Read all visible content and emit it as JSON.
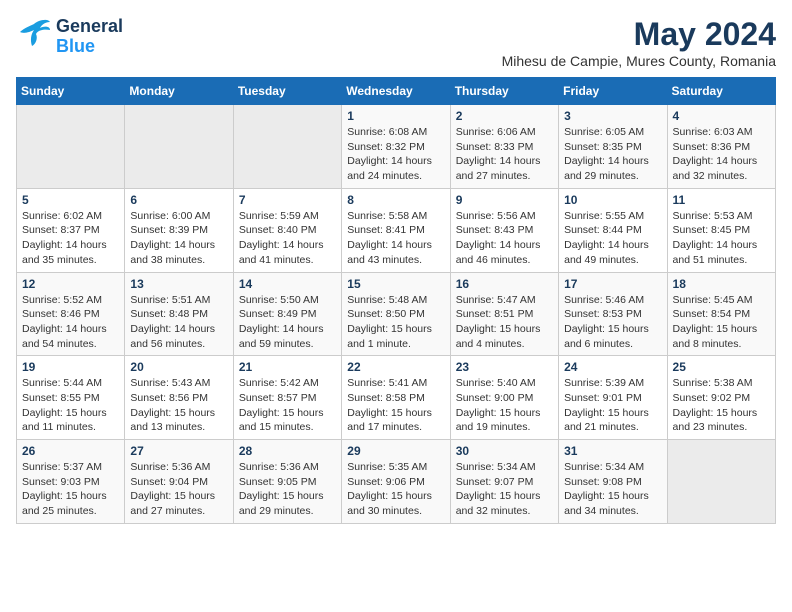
{
  "logo": {
    "line1": "General",
    "line2": "Blue"
  },
  "title": "May 2024",
  "subtitle": "Mihesu de Campie, Mures County, Romania",
  "weekdays": [
    "Sunday",
    "Monday",
    "Tuesday",
    "Wednesday",
    "Thursday",
    "Friday",
    "Saturday"
  ],
  "weeks": [
    [
      {
        "day": "",
        "info": ""
      },
      {
        "day": "",
        "info": ""
      },
      {
        "day": "",
        "info": ""
      },
      {
        "day": "1",
        "info": "Sunrise: 6:08 AM\nSunset: 8:32 PM\nDaylight: 14 hours\nand 24 minutes."
      },
      {
        "day": "2",
        "info": "Sunrise: 6:06 AM\nSunset: 8:33 PM\nDaylight: 14 hours\nand 27 minutes."
      },
      {
        "day": "3",
        "info": "Sunrise: 6:05 AM\nSunset: 8:35 PM\nDaylight: 14 hours\nand 29 minutes."
      },
      {
        "day": "4",
        "info": "Sunrise: 6:03 AM\nSunset: 8:36 PM\nDaylight: 14 hours\nand 32 minutes."
      }
    ],
    [
      {
        "day": "5",
        "info": "Sunrise: 6:02 AM\nSunset: 8:37 PM\nDaylight: 14 hours\nand 35 minutes."
      },
      {
        "day": "6",
        "info": "Sunrise: 6:00 AM\nSunset: 8:39 PM\nDaylight: 14 hours\nand 38 minutes."
      },
      {
        "day": "7",
        "info": "Sunrise: 5:59 AM\nSunset: 8:40 PM\nDaylight: 14 hours\nand 41 minutes."
      },
      {
        "day": "8",
        "info": "Sunrise: 5:58 AM\nSunset: 8:41 PM\nDaylight: 14 hours\nand 43 minutes."
      },
      {
        "day": "9",
        "info": "Sunrise: 5:56 AM\nSunset: 8:43 PM\nDaylight: 14 hours\nand 46 minutes."
      },
      {
        "day": "10",
        "info": "Sunrise: 5:55 AM\nSunset: 8:44 PM\nDaylight: 14 hours\nand 49 minutes."
      },
      {
        "day": "11",
        "info": "Sunrise: 5:53 AM\nSunset: 8:45 PM\nDaylight: 14 hours\nand 51 minutes."
      }
    ],
    [
      {
        "day": "12",
        "info": "Sunrise: 5:52 AM\nSunset: 8:46 PM\nDaylight: 14 hours\nand 54 minutes."
      },
      {
        "day": "13",
        "info": "Sunrise: 5:51 AM\nSunset: 8:48 PM\nDaylight: 14 hours\nand 56 minutes."
      },
      {
        "day": "14",
        "info": "Sunrise: 5:50 AM\nSunset: 8:49 PM\nDaylight: 14 hours\nand 59 minutes."
      },
      {
        "day": "15",
        "info": "Sunrise: 5:48 AM\nSunset: 8:50 PM\nDaylight: 15 hours\nand 1 minute."
      },
      {
        "day": "16",
        "info": "Sunrise: 5:47 AM\nSunset: 8:51 PM\nDaylight: 15 hours\nand 4 minutes."
      },
      {
        "day": "17",
        "info": "Sunrise: 5:46 AM\nSunset: 8:53 PM\nDaylight: 15 hours\nand 6 minutes."
      },
      {
        "day": "18",
        "info": "Sunrise: 5:45 AM\nSunset: 8:54 PM\nDaylight: 15 hours\nand 8 minutes."
      }
    ],
    [
      {
        "day": "19",
        "info": "Sunrise: 5:44 AM\nSunset: 8:55 PM\nDaylight: 15 hours\nand 11 minutes."
      },
      {
        "day": "20",
        "info": "Sunrise: 5:43 AM\nSunset: 8:56 PM\nDaylight: 15 hours\nand 13 minutes."
      },
      {
        "day": "21",
        "info": "Sunrise: 5:42 AM\nSunset: 8:57 PM\nDaylight: 15 hours\nand 15 minutes."
      },
      {
        "day": "22",
        "info": "Sunrise: 5:41 AM\nSunset: 8:58 PM\nDaylight: 15 hours\nand 17 minutes."
      },
      {
        "day": "23",
        "info": "Sunrise: 5:40 AM\nSunset: 9:00 PM\nDaylight: 15 hours\nand 19 minutes."
      },
      {
        "day": "24",
        "info": "Sunrise: 5:39 AM\nSunset: 9:01 PM\nDaylight: 15 hours\nand 21 minutes."
      },
      {
        "day": "25",
        "info": "Sunrise: 5:38 AM\nSunset: 9:02 PM\nDaylight: 15 hours\nand 23 minutes."
      }
    ],
    [
      {
        "day": "26",
        "info": "Sunrise: 5:37 AM\nSunset: 9:03 PM\nDaylight: 15 hours\nand 25 minutes."
      },
      {
        "day": "27",
        "info": "Sunrise: 5:36 AM\nSunset: 9:04 PM\nDaylight: 15 hours\nand 27 minutes."
      },
      {
        "day": "28",
        "info": "Sunrise: 5:36 AM\nSunset: 9:05 PM\nDaylight: 15 hours\nand 29 minutes."
      },
      {
        "day": "29",
        "info": "Sunrise: 5:35 AM\nSunset: 9:06 PM\nDaylight: 15 hours\nand 30 minutes."
      },
      {
        "day": "30",
        "info": "Sunrise: 5:34 AM\nSunset: 9:07 PM\nDaylight: 15 hours\nand 32 minutes."
      },
      {
        "day": "31",
        "info": "Sunrise: 5:34 AM\nSunset: 9:08 PM\nDaylight: 15 hours\nand 34 minutes."
      },
      {
        "day": "",
        "info": ""
      }
    ]
  ]
}
